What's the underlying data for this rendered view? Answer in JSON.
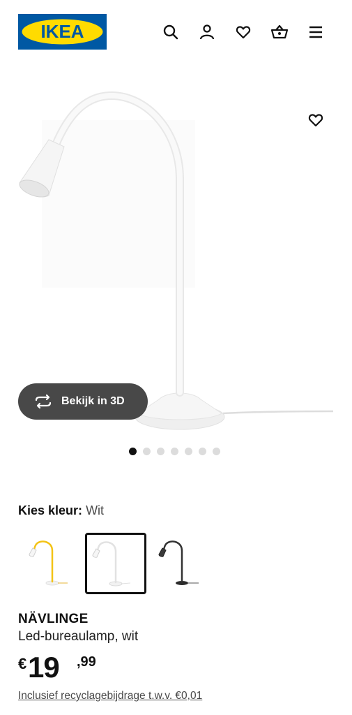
{
  "header": {
    "logo_text": "IKEA",
    "icons": [
      "search-icon",
      "account-icon",
      "favourites-icon",
      "basket-icon",
      "menu-icon"
    ]
  },
  "hero": {
    "image": "white-desk-lamp",
    "favourite_icon": "heart-outline-icon",
    "view_3d_label": "Bekijk in 3D",
    "view_3d_icon": "rotate-3d-icon",
    "carousel": {
      "count": 7,
      "active_index": 0
    }
  },
  "color_select": {
    "label": "Kies kleur:",
    "value": "Wit",
    "options": [
      {
        "name": "yellow-lamp",
        "selected": false
      },
      {
        "name": "white-lamp",
        "selected": true
      },
      {
        "name": "black-lamp",
        "selected": false
      }
    ]
  },
  "product": {
    "name": "NÄVLINGE",
    "description": "Led-bureaulamp, wit",
    "currency": "€",
    "price_integer": "19",
    "price_decimal": ",99",
    "recycle_note": "Inclusief recyclagebijdrage t.w.v. €0,01"
  },
  "colors": {
    "brand_blue": "#0058a3",
    "brand_yellow": "#ffdb00",
    "button_dark": "#484848",
    "text": "#111111"
  }
}
